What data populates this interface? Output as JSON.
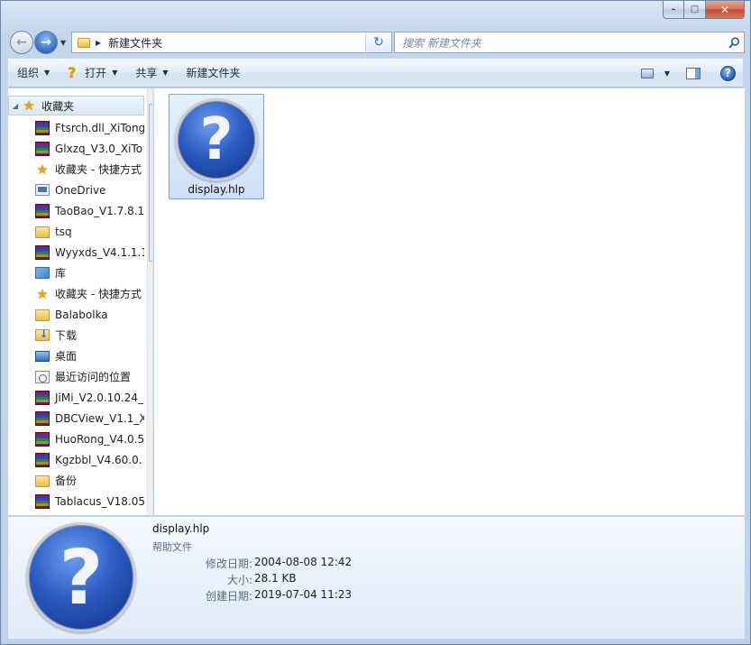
{
  "window": {
    "caption": {
      "minimize": "–",
      "maximize": "□",
      "close": "✕"
    }
  },
  "nav": {
    "back": "←",
    "forward": "→",
    "address_path": "新建文件夹",
    "refresh": "↻",
    "search_placeholder": "搜索 新建文件夹"
  },
  "toolbar": {
    "organize": "组织",
    "open": "打开",
    "share": "共享",
    "new_folder": "新建文件夹",
    "help": "?"
  },
  "sidebar": {
    "favorites_header": "收藏夹",
    "items": [
      {
        "label": "Ftsrch.dll_XiTong",
        "icon": "rar-archive-icon"
      },
      {
        "label": "Glxzq_V3.0_XiTo",
        "icon": "rar-archive-icon"
      },
      {
        "label": "收藏夹 - 快捷方式",
        "icon": "star-icon"
      },
      {
        "label": "OneDrive",
        "icon": "onedrive-icon"
      },
      {
        "label": "TaoBao_V1.7.8.1",
        "icon": "rar-archive-icon"
      },
      {
        "label": "tsq",
        "icon": "folder-icon"
      },
      {
        "label": "Wyyxds_V4.1.1.1",
        "icon": "rar-archive-icon"
      },
      {
        "label": "库",
        "icon": "library-icon"
      },
      {
        "label": "收藏夹 - 快捷方式",
        "icon": "star-icon"
      },
      {
        "label": "Balabolka",
        "icon": "folder-icon"
      },
      {
        "label": "下载",
        "icon": "downloads-folder-icon"
      },
      {
        "label": "桌面",
        "icon": "desktop-icon"
      },
      {
        "label": "最近访问的位置",
        "icon": "recent-places-icon"
      },
      {
        "label": "JiMi_V2.0.10.24_",
        "icon": "rar-archive-icon"
      },
      {
        "label": "DBCView_V1.1_X",
        "icon": "rar-archive-icon"
      },
      {
        "label": "HuoRong_V4.0.5",
        "icon": "rar-archive-icon"
      },
      {
        "label": "Kgzbbl_V4.60.0.",
        "icon": "rar-archive-icon"
      },
      {
        "label": "备份",
        "icon": "folder-icon"
      },
      {
        "label": "Tablacus_V18.05",
        "icon": "rar-archive-icon"
      }
    ]
  },
  "content": {
    "files": [
      {
        "name": "display.hlp",
        "glyph": "?"
      }
    ]
  },
  "details": {
    "glyph": "?",
    "name": "display.hlp",
    "type": "帮助文件",
    "modified_label": "修改日期:",
    "modified_value": "2004-08-08 12:42",
    "size_label": "大小:",
    "size_value": "28.1 KB",
    "created_label": "创建日期:",
    "created_value": "2019-07-04 11:23"
  }
}
